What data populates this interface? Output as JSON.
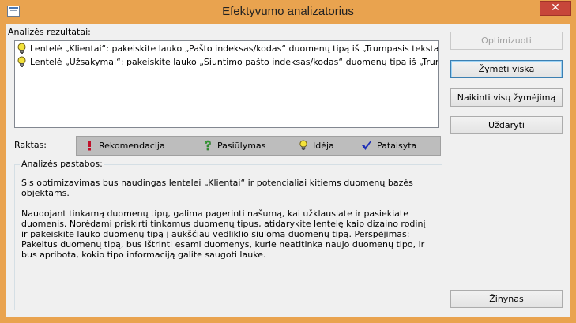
{
  "window": {
    "title": "Efektyvumo analizatorius",
    "close_glyph": "✕",
    "app_icon": "app-window-icon"
  },
  "results": {
    "label": "Analizės rezultatai:",
    "items": [
      {
        "icon": "idea-bulb-icon",
        "text": "Lentelė „Klientai“: pakeiskite lauko „Pašto indeksas/kodas“ duomenų tipą iš „Trumpasis tekstas“ į „Ilga"
      },
      {
        "icon": "idea-bulb-icon",
        "text": "Lentelė „Užsakymai“: pakeiskite lauko „Siuntimo pašto indeksas/kodas“ duomenų tipą iš „Trumpasis te"
      }
    ]
  },
  "buttons": {
    "optimize": "Optimizuoti",
    "select_all": "Žymėti viską",
    "deselect_all": "Naikinti visų žymėjimą",
    "close": "Uždaryti",
    "help": "Žinynas"
  },
  "key": {
    "label": "Raktas:",
    "items": [
      {
        "icon": "recommendation-icon",
        "text": "Rekomendacija",
        "color": "#c0102a"
      },
      {
        "icon": "suggestion-icon",
        "text": "Pasiūlymas",
        "color": "#3aa63a"
      },
      {
        "icon": "idea-bulb-icon",
        "text": "Idėja",
        "color": "#e5d21a"
      },
      {
        "icon": "fixed-check-icon",
        "text": "Pataisyta",
        "color": "#1f2fb8"
      }
    ]
  },
  "notes": {
    "label": "Analizės pastabos:",
    "paragraphs": [
      "Šis optimizavimas bus naudingas lentelei „Klientai“ ir potencialiai kitiems duomenų bazės objektams.",
      "Naudojant tinkamą duomenų tipų, galima pagerinti našumą, kai užklausiate ir pasiekiate duomenis. Norėdami priskirti tinkamus duomenų tipus, atidarykite lentelę kaip dizaino rodinį ir pakeiskite lauko duomenų tipą į aukščiau vedliklio siūlomą duomenų tipą. Perspėjimas: Pakeitus duomenų tipą, bus ištrinti esami duomenys, kurie neatitinka naujo duomenų tipo, ir bus apribota, kokio tipo informaciją galite saugoti lauke."
    ]
  },
  "colors": {
    "frame": "#e9a34f",
    "close_button": "#c7463a",
    "legend_bg": "#bdbdbd"
  }
}
